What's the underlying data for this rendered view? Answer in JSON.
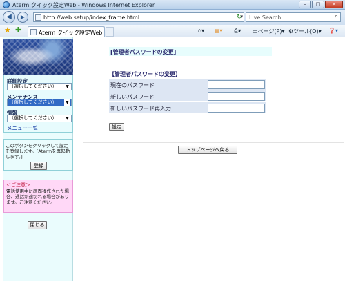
{
  "window": {
    "title": "Aterm クイック設定Web - Windows Internet Explorer",
    "controls": {
      "minimize": "–",
      "maximize": "□",
      "close": "×"
    }
  },
  "address_bar": {
    "url": "http://web.setup/index_frame.html",
    "search_placeholder": "Live Search"
  },
  "tab": {
    "title": "Aterm クイック設定Web"
  },
  "command_bar": {
    "page_menu": "ページ(P)",
    "tools_menu": "ツール(O)"
  },
  "sidebar": {
    "menus": [
      {
        "label": "詳細設定",
        "selected": "（選択してください）"
      },
      {
        "label": "メンテナンス",
        "selected": "（選択してください）"
      },
      {
        "label": "情報",
        "selected": "（選択してください）"
      }
    ],
    "menu_list_link": "メニュー一覧",
    "info_text": "このボタンをクリックして設定を登録します。[Atermを再起動します。]",
    "register_button": "登録",
    "warning_heading": "＜ご注意＞",
    "warning_text": "電話使用中に画面操作された場合、通話が途切れる場合があります。ご注意ください。",
    "close_button": "閉じる"
  },
  "main": {
    "page_title": "[管理者パスワードの変更]",
    "section_title": "【管理者パスワードの変更】",
    "fields": [
      {
        "label": "現在のパスワード",
        "value": ""
      },
      {
        "label": "新しいパスワード",
        "value": ""
      },
      {
        "label": "新しいパスワード再入力",
        "value": ""
      }
    ],
    "submit_button": "設定",
    "top_page_button": "トップページへ戻る"
  },
  "icons": {
    "back": "back-arrow-icon",
    "forward": "forward-arrow-icon",
    "refresh": "refresh-icon",
    "stop": "stop-icon",
    "search": "search-icon",
    "favorites": "favorites-star-icon",
    "add_favorites": "add-favorites-icon",
    "home": "home-icon",
    "feeds": "rss-feed-icon",
    "print": "printer-icon",
    "help": "help-icon"
  },
  "colors": {
    "sidebar_bg": "#eafcfd",
    "warning_bg": "#ffd8f7",
    "form_row_bg": "#dde6f3",
    "title_text": "#2a2a6e"
  }
}
